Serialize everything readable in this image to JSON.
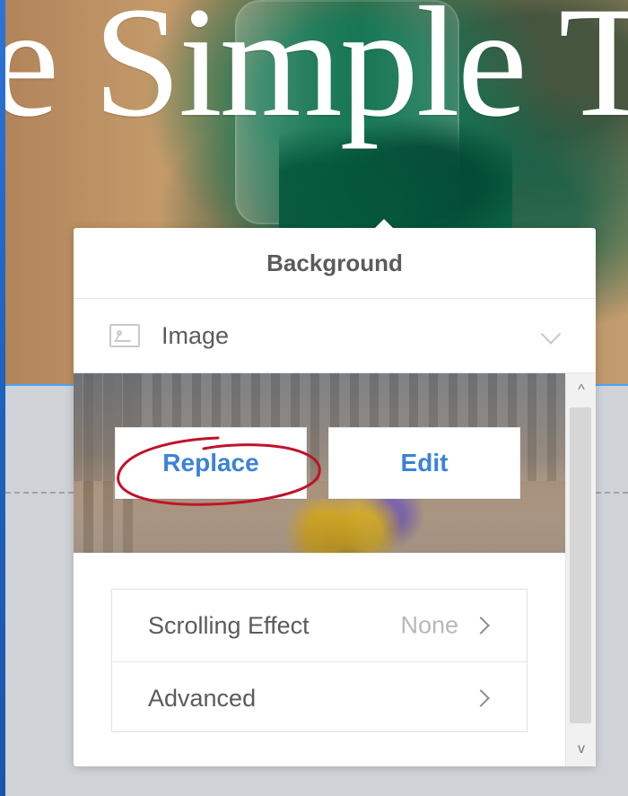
{
  "hero": {
    "title": "e Simple T"
  },
  "background_popover": {
    "title": "Background",
    "type": {
      "label": "Image",
      "icon": "image-icon",
      "dropdown_icon": "chevron-down-icon"
    },
    "preview": {
      "replace_label": "Replace",
      "edit_label": "Edit"
    },
    "options": [
      {
        "label": "Scrolling Effect",
        "value": "None",
        "icon": "chevron-right-icon"
      },
      {
        "label": "Advanced",
        "value": "",
        "icon": "chevron-right-icon"
      }
    ],
    "scrollbar": {
      "up_glyph": "^",
      "down_glyph": "v"
    }
  },
  "colors": {
    "accent_link": "#3b83d6",
    "annotation_red": "#c0122b",
    "text_primary": "#5b5b5b",
    "text_muted": "#b8b8b8"
  }
}
